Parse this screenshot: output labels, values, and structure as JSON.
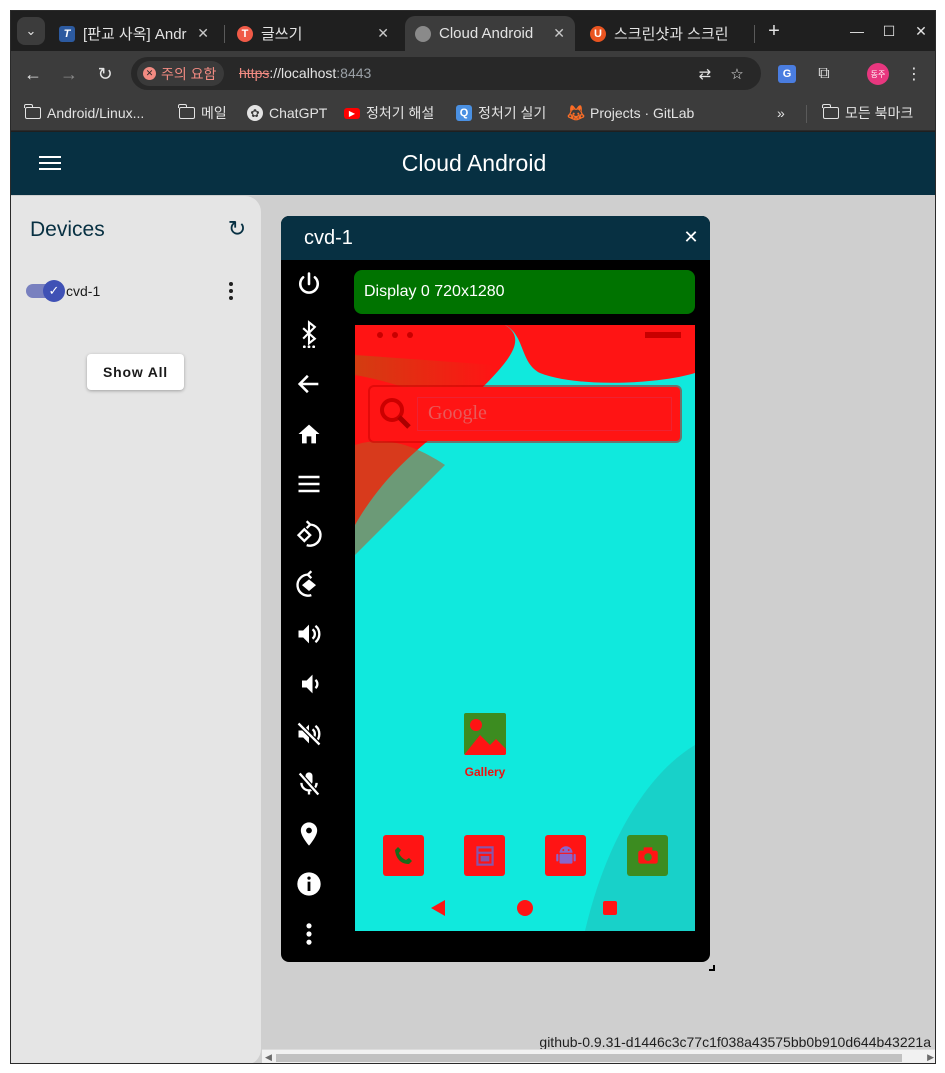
{
  "browser": {
    "tabs": [
      {
        "title": "[판교 사옥] Andr",
        "favicon": "T",
        "favicon_color": "#2c5aa0",
        "active": false
      },
      {
        "title": "글쓰기",
        "favicon": "T",
        "favicon_color": "#f05a47",
        "active": false
      },
      {
        "title": "Cloud Android",
        "favicon": "",
        "favicon_color": "#8a8a8a",
        "active": true
      },
      {
        "title": "스크린샷과 스크린",
        "favicon": "U",
        "favicon_color": "#e95420",
        "active": false
      }
    ],
    "security_label": "주의 요함",
    "url_scheme": "https",
    "url_host": "://localhost",
    "url_port": ":8443",
    "avatar_text": "동주",
    "bookmarks": [
      {
        "label": "Android/Linux...",
        "icon": "folder-icon"
      },
      {
        "label": "메일",
        "icon": "folder-icon"
      },
      {
        "label": "ChatGPT",
        "icon": "chatgpt-icon"
      },
      {
        "label": "정처기 해설",
        "icon": "youtube-icon"
      },
      {
        "label": "정처기 실기",
        "icon": "q-icon"
      },
      {
        "label": "Projects · GitLab",
        "icon": "gitlab-icon"
      }
    ],
    "bookmarks_overflow": "»",
    "all_bookmarks": "모든 북마크"
  },
  "app": {
    "title": "Cloud Android",
    "sidebar": {
      "title": "Devices",
      "devices": [
        {
          "name": "cvd-1",
          "enabled": true
        }
      ],
      "show_all_label": "Show All"
    },
    "device_window": {
      "title": "cvd-1",
      "display_label": "Display 0 720x1280",
      "controls": [
        "power-icon",
        "bluetooth-icon",
        "back-icon",
        "home-icon",
        "menu-icon",
        "rotate-left-icon",
        "rotate-right-icon",
        "volume-up-icon",
        "volume-down-icon",
        "volume-mute-icon",
        "mic-off-icon",
        "location-icon",
        "info-icon",
        "more-icon"
      ],
      "screen": {
        "search_placeholder": "Google",
        "gallery_label": "Gallery",
        "dock": [
          "phone-icon",
          "messages-icon",
          "android-icon",
          "camera-icon"
        ]
      }
    },
    "version": "github-0.9.31-d1446c3c77c1f038a43575bb0b910d644b43221a"
  },
  "colors": {
    "app_bar": "#073042",
    "display_bar": "#007300",
    "screen_bg": "#10e9dd",
    "screen_overlay": "#ff1414",
    "toggle_accent": "#3f51b5"
  }
}
